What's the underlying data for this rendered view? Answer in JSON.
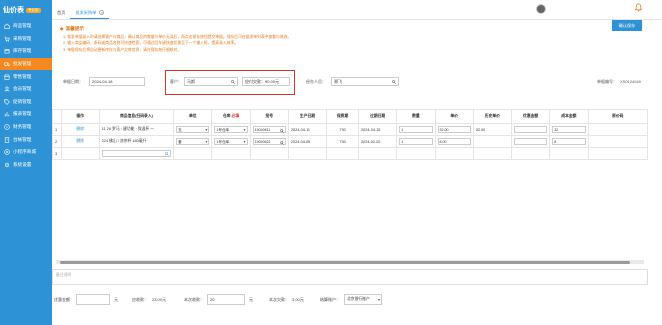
{
  "app": {
    "logo": "仙价表",
    "badge": "专业版"
  },
  "sidebar": {
    "items": [
      {
        "label": "商品管理",
        "icon": "home-icon",
        "active": false
      },
      {
        "label": "采购管理",
        "icon": "cart-icon",
        "active": false
      },
      {
        "label": "库存管理",
        "icon": "box-icon",
        "active": false
      },
      {
        "label": "批发管理",
        "icon": "truck-icon",
        "active": true
      },
      {
        "label": "零售管理",
        "icon": "shop-icon",
        "active": false
      },
      {
        "label": "会员管理",
        "icon": "user-icon",
        "active": false
      },
      {
        "label": "促销管理",
        "icon": "tag-icon",
        "active": false
      },
      {
        "label": "报表管理",
        "icon": "chart-icon",
        "active": false
      },
      {
        "label": "财务管理",
        "icon": "money-icon",
        "active": false
      },
      {
        "label": "台帐管理",
        "icon": "book-icon",
        "active": false
      },
      {
        "label": "小程序商城",
        "icon": "mini-program-icon",
        "active": false
      },
      {
        "label": "系统设置",
        "icon": "gear-icon",
        "active": false
      }
    ]
  },
  "tabs": [
    {
      "label": "首页"
    },
    {
      "label": "批发采购单",
      "close": "×"
    }
  ],
  "header": {
    "save_label": "确认保存"
  },
  "tips": {
    "title": "温馨提示",
    "lines": [
      "1. 批发单据录入时请选择客户与商品，确认商品的数量与单价无误后，再点击保存按钮提交单据，保存后可在批发单列表中查看与修改。",
      "2. 输入商品编码、条码或商品名称可快速检索，可通过回车键快速切换至下一个输入框，提高录入效率。",
      "3. 单据保存后将自动更新库存与客户欠款信息，请在保存前仔细核对。"
    ]
  },
  "form": {
    "date_label": "单据日期：",
    "date_value": "2024-04-18",
    "customer_label": "客户：",
    "customer_value": "马斯",
    "balance_label": "应付欠款：90.00元",
    "staff_label": "经办人员：",
    "staff_value": "郑飞",
    "order_no_label": "单据编号：",
    "order_no_value": "XS0124049"
  },
  "table": {
    "headers": [
      "操作",
      "商品信息(扫码录入)",
      "单位",
      "仓库",
      "批号",
      "生产日期",
      "保质期",
      "过期日期",
      "数量",
      "单价",
      "历史单价",
      "优惠金额",
      "成本金额",
      "原价码"
    ],
    "warehouse_req": "必填",
    "rows": [
      {
        "no": "1",
        "action": "删除",
        "product": "11 26 罗马 · 建功能 · 保温杯 一",
        "unit": "支",
        "warehouse": "1号仓库",
        "batch": "19040611",
        "mfg": "2024-04-11",
        "shelf": "730",
        "exp": "2024-04-15",
        "qty": "1",
        "price": "32.00",
        "hist_price": "32.00",
        "discount": "",
        "cost": "32"
      },
      {
        "no": "2",
        "action": "删除",
        "product": "224 佛山 / 凉茶杯 180毫升",
        "unit": "套",
        "warehouse": "1号仓库",
        "batch": "19040621",
        "mfg": "2024-04-05",
        "shelf": "730",
        "exp": "2024-02-02",
        "qty": "1",
        "price": "8.00",
        "hist_price": "",
        "discount": "",
        "cost": "8"
      }
    ],
    "empty_row_no": "3"
  },
  "remark": {
    "placeholder": "备注说明"
  },
  "footer": {
    "discount_label": "优惠金额：",
    "discount_unit": "元",
    "total_label": "应收款：",
    "total_value": "23.00元",
    "received_label": "本次收款：",
    "received_value": "20",
    "received_unit": "元",
    "owed_label": "本次欠款：",
    "owed_value": "3.00元",
    "account_label": "结算账户：",
    "account_value": "北京银行账户"
  }
}
